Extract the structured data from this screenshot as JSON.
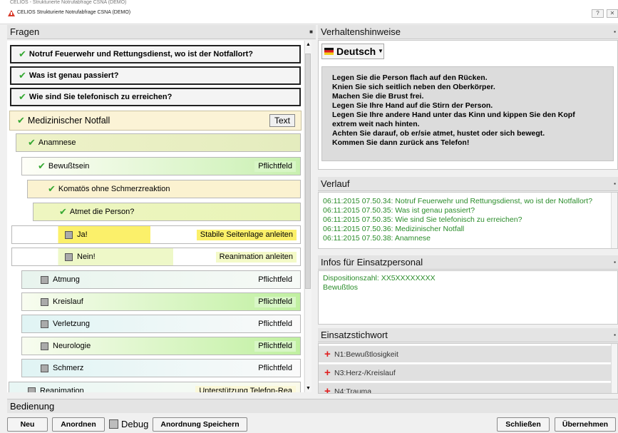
{
  "window": {
    "background_title": "CELIOS - Strukturierte Notrufabfrage CSNA (DEMO)",
    "title": "CELIOS Strukturierte Notrufabfrage CSNA (DEMO)",
    "help_button": "?",
    "close_button": "✕"
  },
  "fragen": {
    "header": "Fragen",
    "items": [
      {
        "label": "Notruf Feuerwehr und Rettungsdienst, wo ist der Notfallort?",
        "state": "checked",
        "tag": ""
      },
      {
        "label": "Was ist genau passiert?",
        "state": "checked",
        "tag": ""
      },
      {
        "label": "Wie sind Sie telefonisch zu erreichen?",
        "state": "checked",
        "tag": ""
      },
      {
        "label": "Medizinischer Notfall",
        "state": "checked",
        "tag": "",
        "button": "Text"
      },
      {
        "label": "Anamnese",
        "state": "checked",
        "tag": ""
      },
      {
        "label": "Bewußtsein",
        "state": "checked",
        "tag": "Pflichtfeld"
      },
      {
        "label": "Komatös ohne Schmerzreaktion",
        "state": "checked",
        "tag": ""
      },
      {
        "label": "Atmet die Person?",
        "state": "checked",
        "tag": ""
      },
      {
        "label": "Ja!",
        "state": "box",
        "tag": "Stabile Seitenlage anleiten"
      },
      {
        "label": "Nein!",
        "state": "box",
        "tag": "Reanimation anleiten"
      },
      {
        "label": "Atmung",
        "state": "box",
        "tag": "Pflichtfeld"
      },
      {
        "label": "Kreislauf",
        "state": "box",
        "tag": "Pflichtfeld"
      },
      {
        "label": "Verletzung",
        "state": "box",
        "tag": "Pflichtfeld"
      },
      {
        "label": "Neurologie",
        "state": "box",
        "tag": "Pflichtfeld"
      },
      {
        "label": "Schmerz",
        "state": "box",
        "tag": "Pflichtfeld"
      },
      {
        "label": "Reanimation",
        "state": "box",
        "tag": "Unterstützung Telefon-Rea"
      }
    ]
  },
  "verhalten": {
    "header": "Verhaltenshinweise",
    "language": "Deutsch",
    "lines": [
      "Legen Sie die Person flach auf den Rücken.",
      "Knien Sie sich seitlich neben den Oberkörper.",
      "Machen Sie die Brust frei.",
      "Legen Sie Ihre Hand auf die Stirn der Person.",
      "Legen Sie Ihre andere Hand unter das Kinn und kippen Sie den Kopf",
      "extrem weit nach hinten.",
      "Achten Sie darauf, ob er/sie atmet, hustet oder sich bewegt.",
      "Kommen Sie dann zurück ans Telefon!"
    ]
  },
  "verlauf": {
    "header": "Verlauf",
    "entries": [
      "06:11:2015 07.50.34: Notruf Feuerwehr und Rettungsdienst, wo ist der Notfallort?",
      "06:11:2015 07.50.35: Was ist genau passiert?",
      "06:11:2015 07.50.35: Wie sind Sie telefonisch zu erreichen?",
      "06:11:2015 07.50.36: Medizinischer Notfall",
      "06:11:2015 07.50.38: Anamnese"
    ]
  },
  "infos": {
    "header": "Infos für Einsatzpersonal",
    "lines": [
      "Dispositionszahl: XX5XXXXXXXX",
      "Bewußtlos"
    ]
  },
  "einsatz": {
    "header": "Einsatzstichwort",
    "items": [
      "N1:Bewußtlosigkeit",
      "N3:Herz-/Kreislauf",
      "N4:Trauma"
    ]
  },
  "bedienung": {
    "header": "Bedienung",
    "neu": "Neu",
    "anordnen": "Anordnen",
    "debug": "Debug",
    "speichern": "Anordnung Speichern",
    "schliessen": "Schließen",
    "uebernehmen": "Übernehmen"
  },
  "colors": {
    "check": "#35a832",
    "log_text": "#2a8c2a",
    "cross": "#e02020"
  }
}
